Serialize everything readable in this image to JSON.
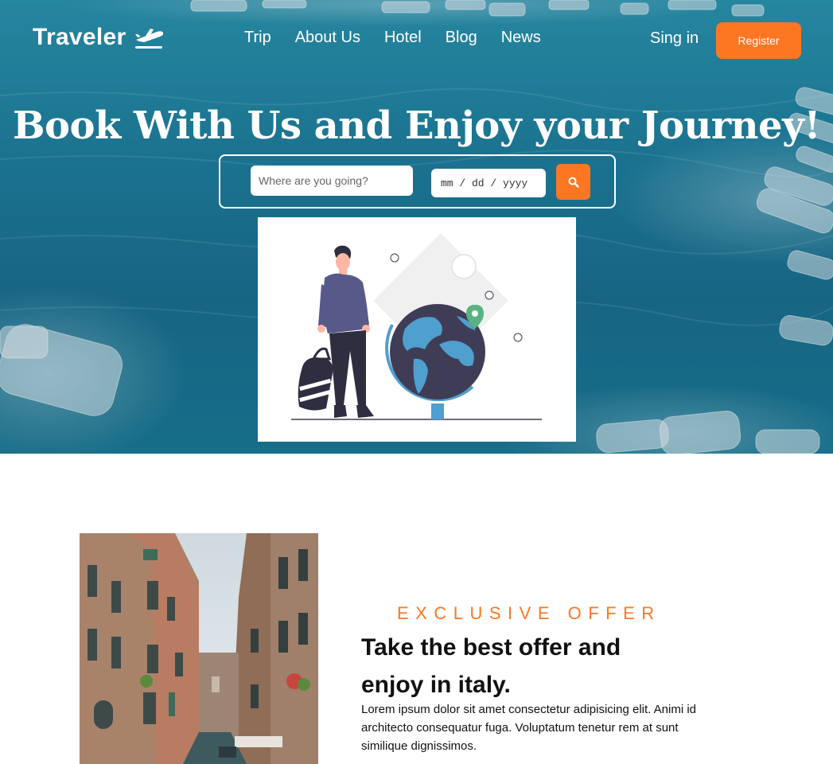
{
  "brand": {
    "name": "Traveler",
    "icon": "airplane-takeoff-icon"
  },
  "nav": {
    "items": [
      {
        "label": "Trip"
      },
      {
        "label": "About Us"
      },
      {
        "label": "Hotel"
      },
      {
        "label": "Blog"
      },
      {
        "label": "News"
      }
    ],
    "signin_label": "Sing in",
    "register_label": "Register"
  },
  "hero": {
    "headline": "Book With Us and Enjoy your Journey!",
    "search": {
      "placeholder": "Where are you going?",
      "date_placeholder": "mm / dd / yyyy",
      "button_icon": "search-icon"
    },
    "illustration": "traveler-with-globe-illustration"
  },
  "offer": {
    "eyebrow": "EXCLUSIVE OFFER",
    "title_line1": "Take the best offer and",
    "title_line2": "enjoy in italy.",
    "body": "Lorem ipsum dolor sit amet consectetur adipisicing elit. Animi id architecto consequatur fuga. Voluptatum tenetur rem at sunt similique dignissimos.",
    "photo": "venice-canal-photo"
  },
  "colors": {
    "accent": "#fd7723",
    "hero_water": "#1f7d9c",
    "text": "#111111"
  }
}
